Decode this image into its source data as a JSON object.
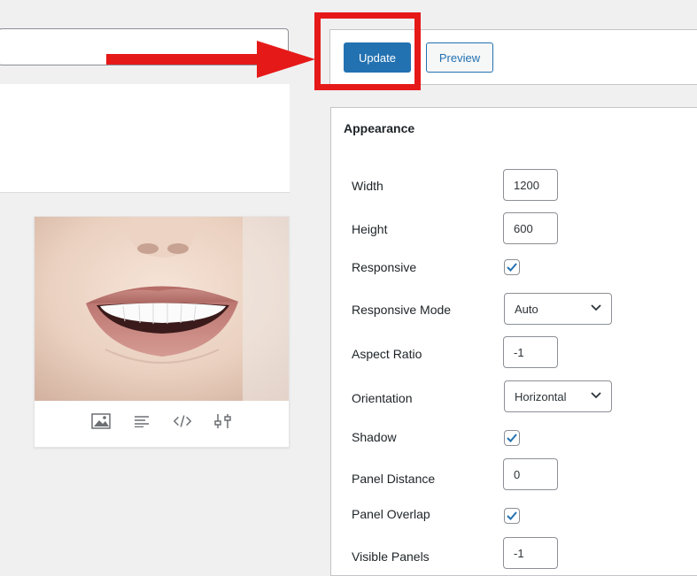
{
  "publish": {
    "update_label": "Update",
    "preview_label": "Preview"
  },
  "image_toolbar": {
    "icons": [
      "image-icon",
      "text-lines-icon",
      "code-icon",
      "sliders-icon"
    ]
  },
  "settings": {
    "title": "Appearance",
    "width": {
      "label": "Width",
      "value": "1200"
    },
    "height": {
      "label": "Height",
      "value": "600"
    },
    "responsive": {
      "label": "Responsive",
      "checked": true
    },
    "responsive_mode": {
      "label": "Responsive Mode",
      "value": "Auto"
    },
    "aspect_ratio": {
      "label": "Aspect Ratio",
      "value": "-1"
    },
    "orientation": {
      "label": "Orientation",
      "value": "Horizontal"
    },
    "shadow": {
      "label": "Shadow",
      "checked": true
    },
    "panel_distance": {
      "label": "Panel Distance",
      "value": "0"
    },
    "panel_overlap": {
      "label": "Panel Overlap",
      "checked": true
    },
    "visible_panels": {
      "label": "Visible Panels",
      "value": "-1"
    }
  },
  "colors": {
    "primary": "#2271b1",
    "highlight": "#e61919",
    "background": "#f0f0f1"
  }
}
